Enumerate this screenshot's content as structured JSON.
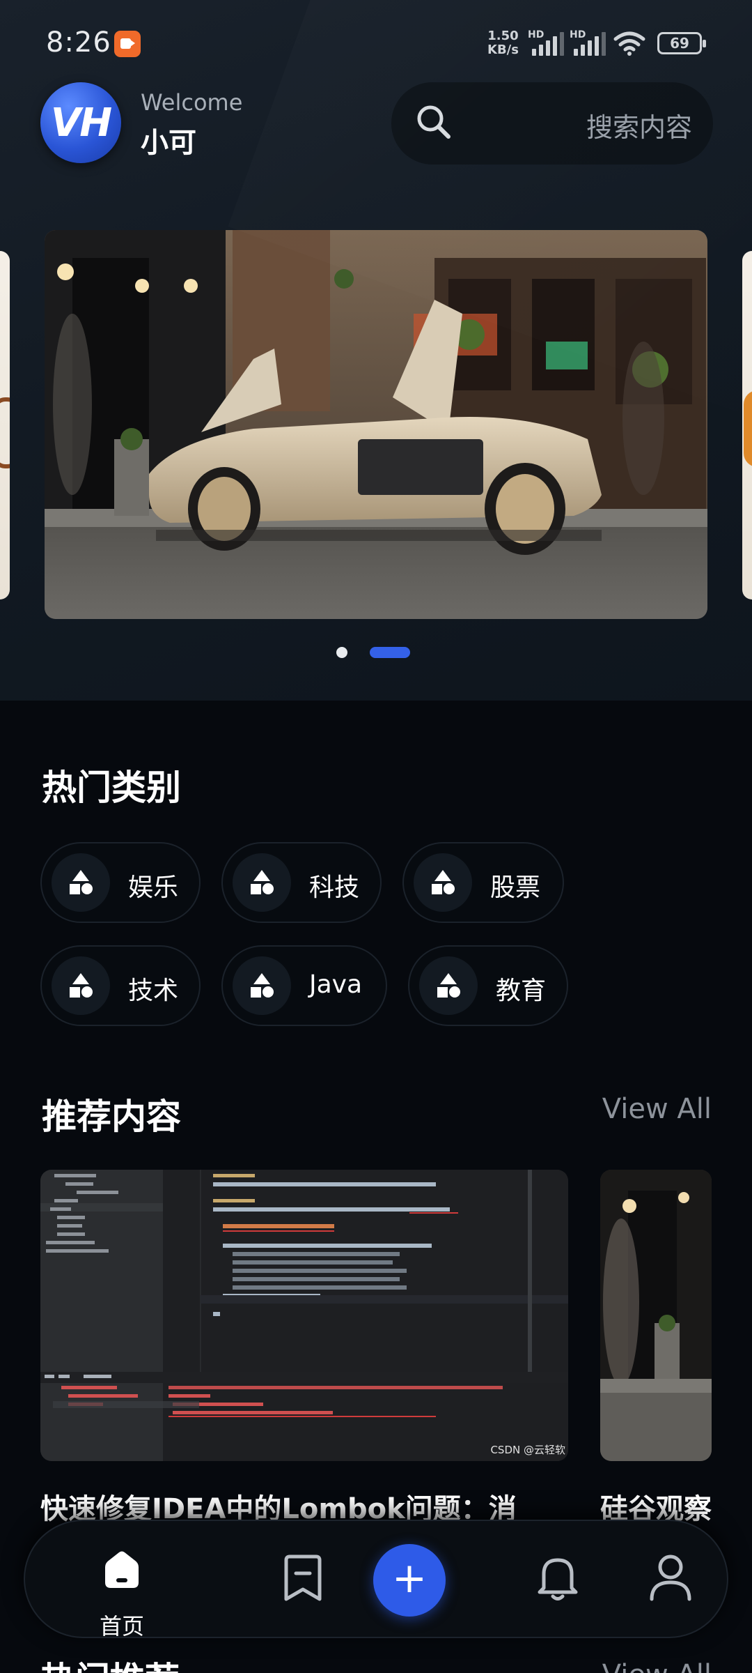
{
  "status_bar": {
    "time": "8:26",
    "net_speed_value": "1.50",
    "net_speed_unit": "KB/s",
    "hd_label_1": "HD",
    "hd_label_2": "HD",
    "battery": "69"
  },
  "header": {
    "avatar_text": "VH",
    "welcome": "Welcome",
    "username": "小可",
    "search_placeholder": "搜索内容"
  },
  "carousel": {
    "page_count": 2,
    "active_index": 1
  },
  "categories": {
    "title": "热门类别",
    "items": [
      {
        "label": "娱乐"
      },
      {
        "label": "科技"
      },
      {
        "label": "股票"
      },
      {
        "label": "技术"
      },
      {
        "label": "Java"
      },
      {
        "label": "教育"
      }
    ]
  },
  "recommended": {
    "title": "推荐内容",
    "view_all": "View All",
    "cards": [
      {
        "title": "快速修复IDEA中的Lombok问题：消",
        "watermark": "CSDN @云轻软"
      },
      {
        "title": "硅谷观察"
      }
    ]
  },
  "next_section": {
    "title": "热门推荐",
    "view_all": "View All"
  },
  "bottom_nav": {
    "home_label": "首页",
    "fab_symbol": "+"
  },
  "colors": {
    "accent": "#2e5be8",
    "background": "#06090e",
    "hero_background": "#151d26"
  }
}
